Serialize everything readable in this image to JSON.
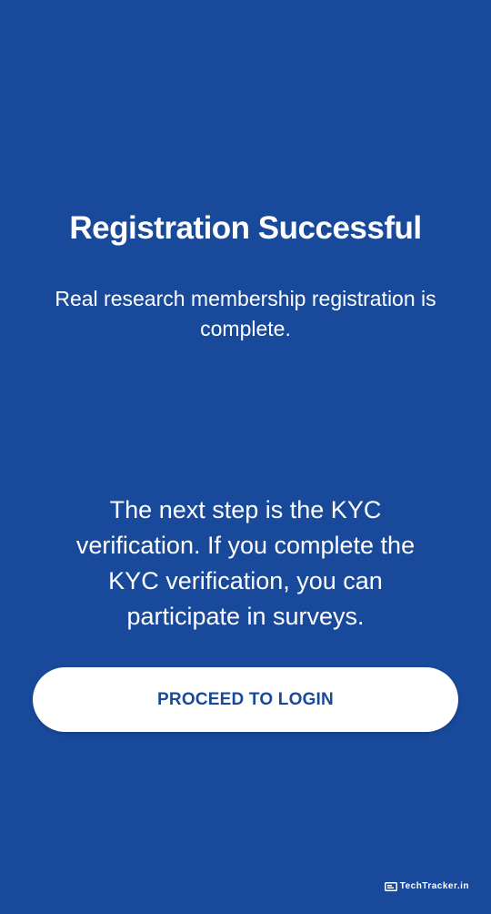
{
  "screen": {
    "title": "Registration Successful",
    "subtitle": "Real research membership registration is complete.",
    "kyc_message": "The next step is the KYC verification. If you complete the KYC verification, you can participate in surveys.",
    "proceed_button_label": "PROCEED TO LOGIN"
  },
  "watermark": {
    "icon": "monitor-icon",
    "text": "TechTracker.in"
  },
  "colors": {
    "background": "#18499a",
    "button_background": "#ffffff",
    "button_text": "#18499a",
    "text": "#ffffff"
  }
}
